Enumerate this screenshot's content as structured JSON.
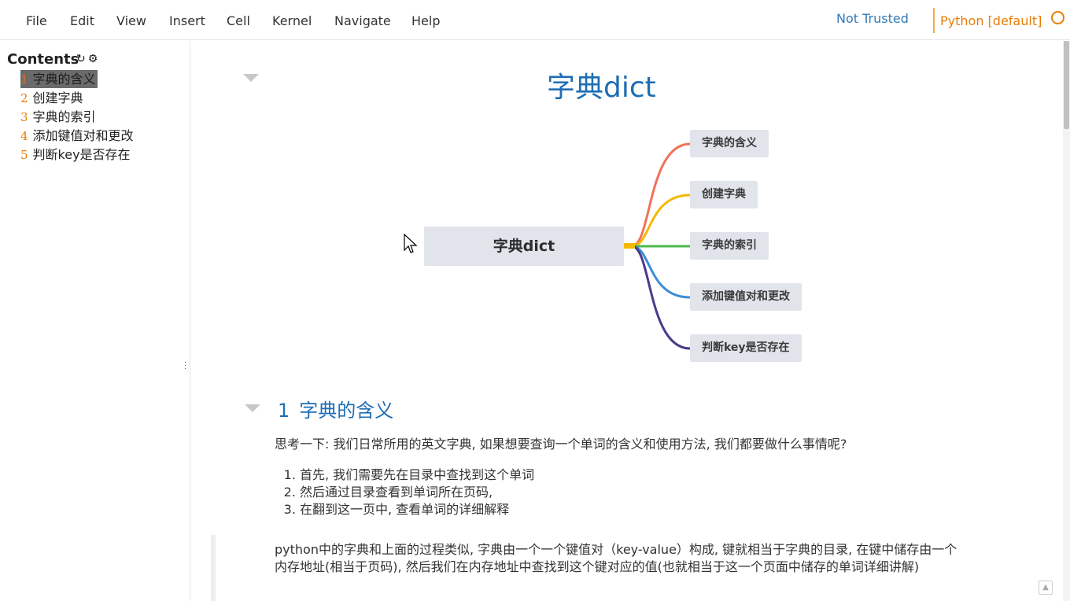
{
  "menubar": {
    "items": [
      "File",
      "Edit",
      "View",
      "Insert",
      "Cell",
      "Kernel",
      "Navigate",
      "Help"
    ],
    "trust_status": "Not Trusted",
    "kernel_name": "Python [default]"
  },
  "toc": {
    "header": "Contents",
    "items": [
      {
        "num": "1",
        "label": "字典的含义",
        "active": true
      },
      {
        "num": "2",
        "label": "创建字典"
      },
      {
        "num": "3",
        "label": "字典的索引"
      },
      {
        "num": "4",
        "label": "添加键值对和更改"
      },
      {
        "num": "5",
        "label": "判断key是否存在"
      }
    ]
  },
  "notebook": {
    "title": "字典dict",
    "mindmap": {
      "root": "字典dict",
      "nodes": [
        "字典的含义",
        "创建字典",
        "字典的索引",
        "添加键值对和更改",
        "判断key是否存在"
      ],
      "branch_colors": [
        "#f0725a",
        "#f5b800",
        "#4cb84c",
        "#3c8dd6",
        "#4a3a8c"
      ]
    },
    "section1": {
      "num": "1",
      "title": "字典的含义",
      "intro": "思考一下: 我们日常所用的英文字典, 如果想要查询一个单词的含义和使用方法, 我们都要做什么事情呢?",
      "list": [
        "首先, 我们需要先在目录中查找到这个单词",
        "然后通过目录查看到单词所在页码,",
        "在翻到这一页中, 查看单词的详细解释"
      ],
      "quote": "python中的字典和上面的过程类似, 字典由一个一个键值对（key-value）构成, 键就相当于字典的目录, 在键中储存由一个内存地址(相当于页码), 然后我们在内存地址中查找到这个键对应的值(也就相当于这一个页面中储存的单词详细讲解)"
    }
  }
}
